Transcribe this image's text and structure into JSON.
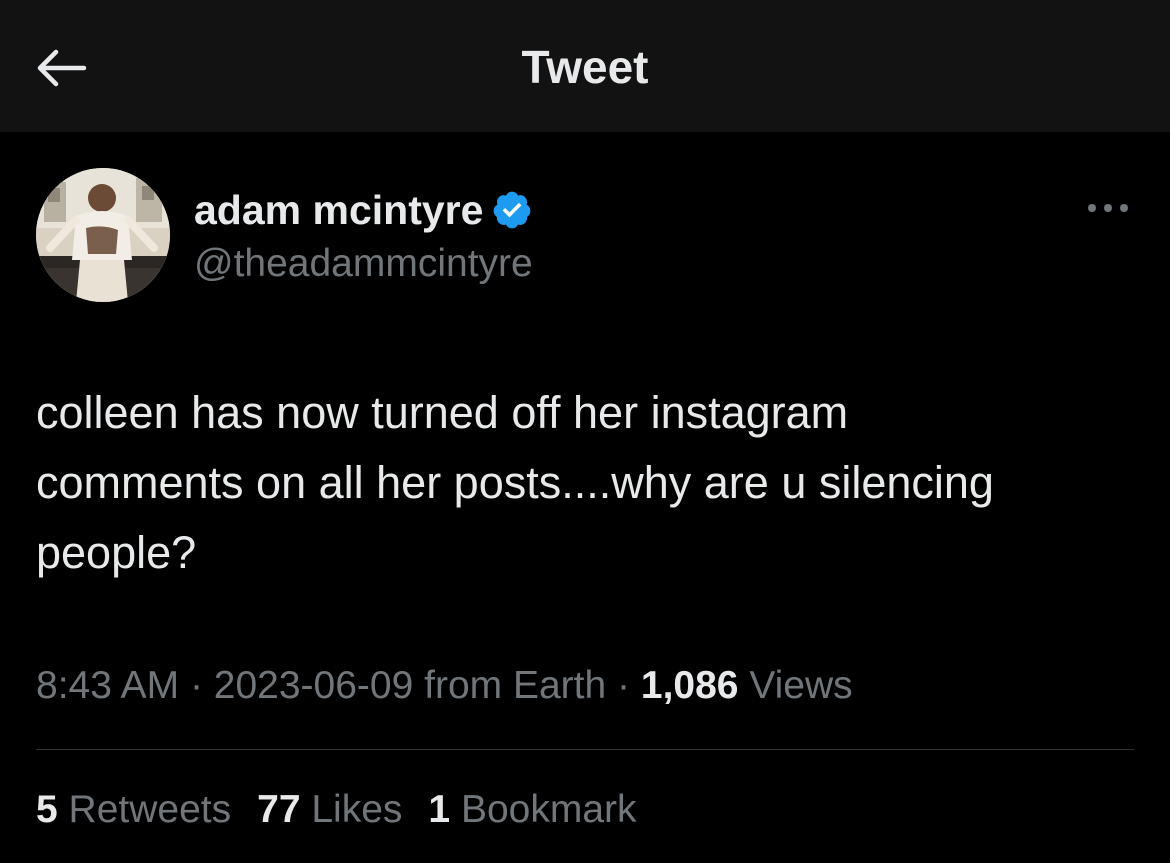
{
  "header": {
    "title": "Tweet",
    "back_icon": "arrow-left-icon"
  },
  "author": {
    "name": "adam mcintyre",
    "handle": "@theadammcintyre",
    "verified": true,
    "verified_color": "#1d9bf0"
  },
  "tweet": {
    "text": "colleen has now turned off her instagram\ncomments on all her posts....why are u silencing\npeople?",
    "time": "8:43 AM",
    "separator": "·",
    "date": "2023-06-09",
    "source": "from Earth",
    "views_count": "1,086",
    "views_label": "Views"
  },
  "stats": {
    "retweets_count": "5",
    "retweets_label": "Retweets",
    "likes_count": "77",
    "likes_label": "Likes",
    "bookmarks_count": "1",
    "bookmarks_label": "Bookmark"
  },
  "colors": {
    "background": "#000000",
    "topbar": "#121212",
    "primary_text": "#e7e9ea",
    "secondary_text": "#71767b",
    "divider": "#2f3336"
  }
}
